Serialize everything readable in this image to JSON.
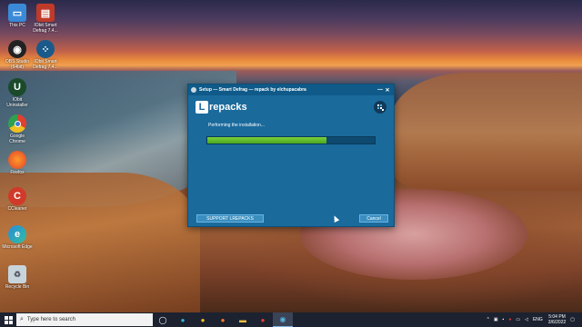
{
  "desktop": {
    "icons": [
      {
        "label": "This PC"
      },
      {
        "label": "IObit Smart Defrag 7.4..."
      },
      {
        "label": "OBS Studio (64bit)"
      },
      {
        "label": "IObit Smart Defrag 7.4..."
      },
      {
        "label": "IObit Uninstaller"
      },
      {
        "label": "Google Chrome"
      },
      {
        "label": "Firefox"
      },
      {
        "label": "CCleaner"
      },
      {
        "label": "Microsoft Edge"
      },
      {
        "label": "Recycle Bin"
      }
    ]
  },
  "setup_window": {
    "title": "Setup — Smart Defrag — repack by elchupacabra",
    "minimize": "—",
    "close": "✕",
    "logo_letter": "L",
    "logo_text": "repacks",
    "status": "Performing the installation...",
    "progress": 0.71,
    "support_button": "SUPPORT LREPACKS",
    "cancel_button": "Cancel"
  },
  "taskbar": {
    "search_placeholder": "Type here to search",
    "language": "ENG",
    "time": "5:04 PM",
    "date": "3/6/2022"
  },
  "colors": {
    "window_bg": "#1a6a9c",
    "progress_fill": "#5ab828",
    "taskbar": "#1c2230"
  }
}
